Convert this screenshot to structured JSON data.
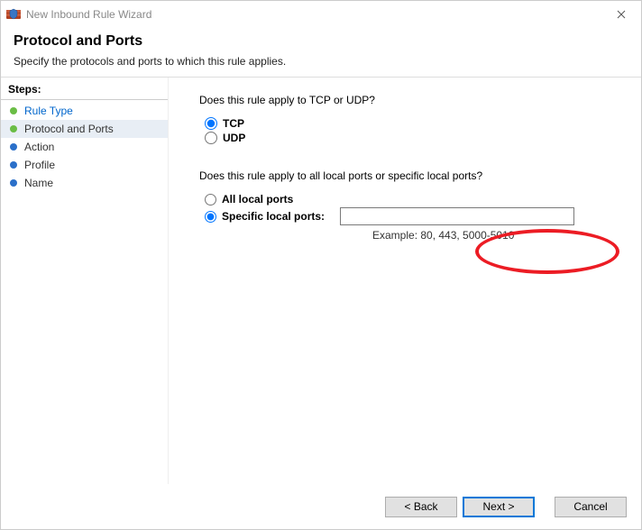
{
  "window": {
    "title": "New Inbound Rule Wizard"
  },
  "header": {
    "title": "Protocol and Ports",
    "subtitle": "Specify the protocols and ports to which this rule applies."
  },
  "sidebar": {
    "label": "Steps:",
    "items": [
      {
        "label": "Rule Type",
        "bullet": "green",
        "state": "done"
      },
      {
        "label": "Protocol and Ports",
        "bullet": "green",
        "state": "current"
      },
      {
        "label": "Action",
        "bullet": "blue",
        "state": "pending"
      },
      {
        "label": "Profile",
        "bullet": "blue",
        "state": "pending"
      },
      {
        "label": "Name",
        "bullet": "blue",
        "state": "pending"
      }
    ]
  },
  "main": {
    "q1": "Does this rule apply to TCP or UDP?",
    "proto": {
      "tcp": "TCP",
      "udp": "UDP",
      "selected": "tcp"
    },
    "q2": "Does this rule apply to all local ports or specific local ports?",
    "ports": {
      "all": "All local ports",
      "specific": "Specific local ports:",
      "selected": "specific",
      "input_value": "",
      "example": "Example: 80, 443, 5000-5010"
    }
  },
  "footer": {
    "back": "< Back",
    "next": "Next >",
    "cancel": "Cancel"
  }
}
